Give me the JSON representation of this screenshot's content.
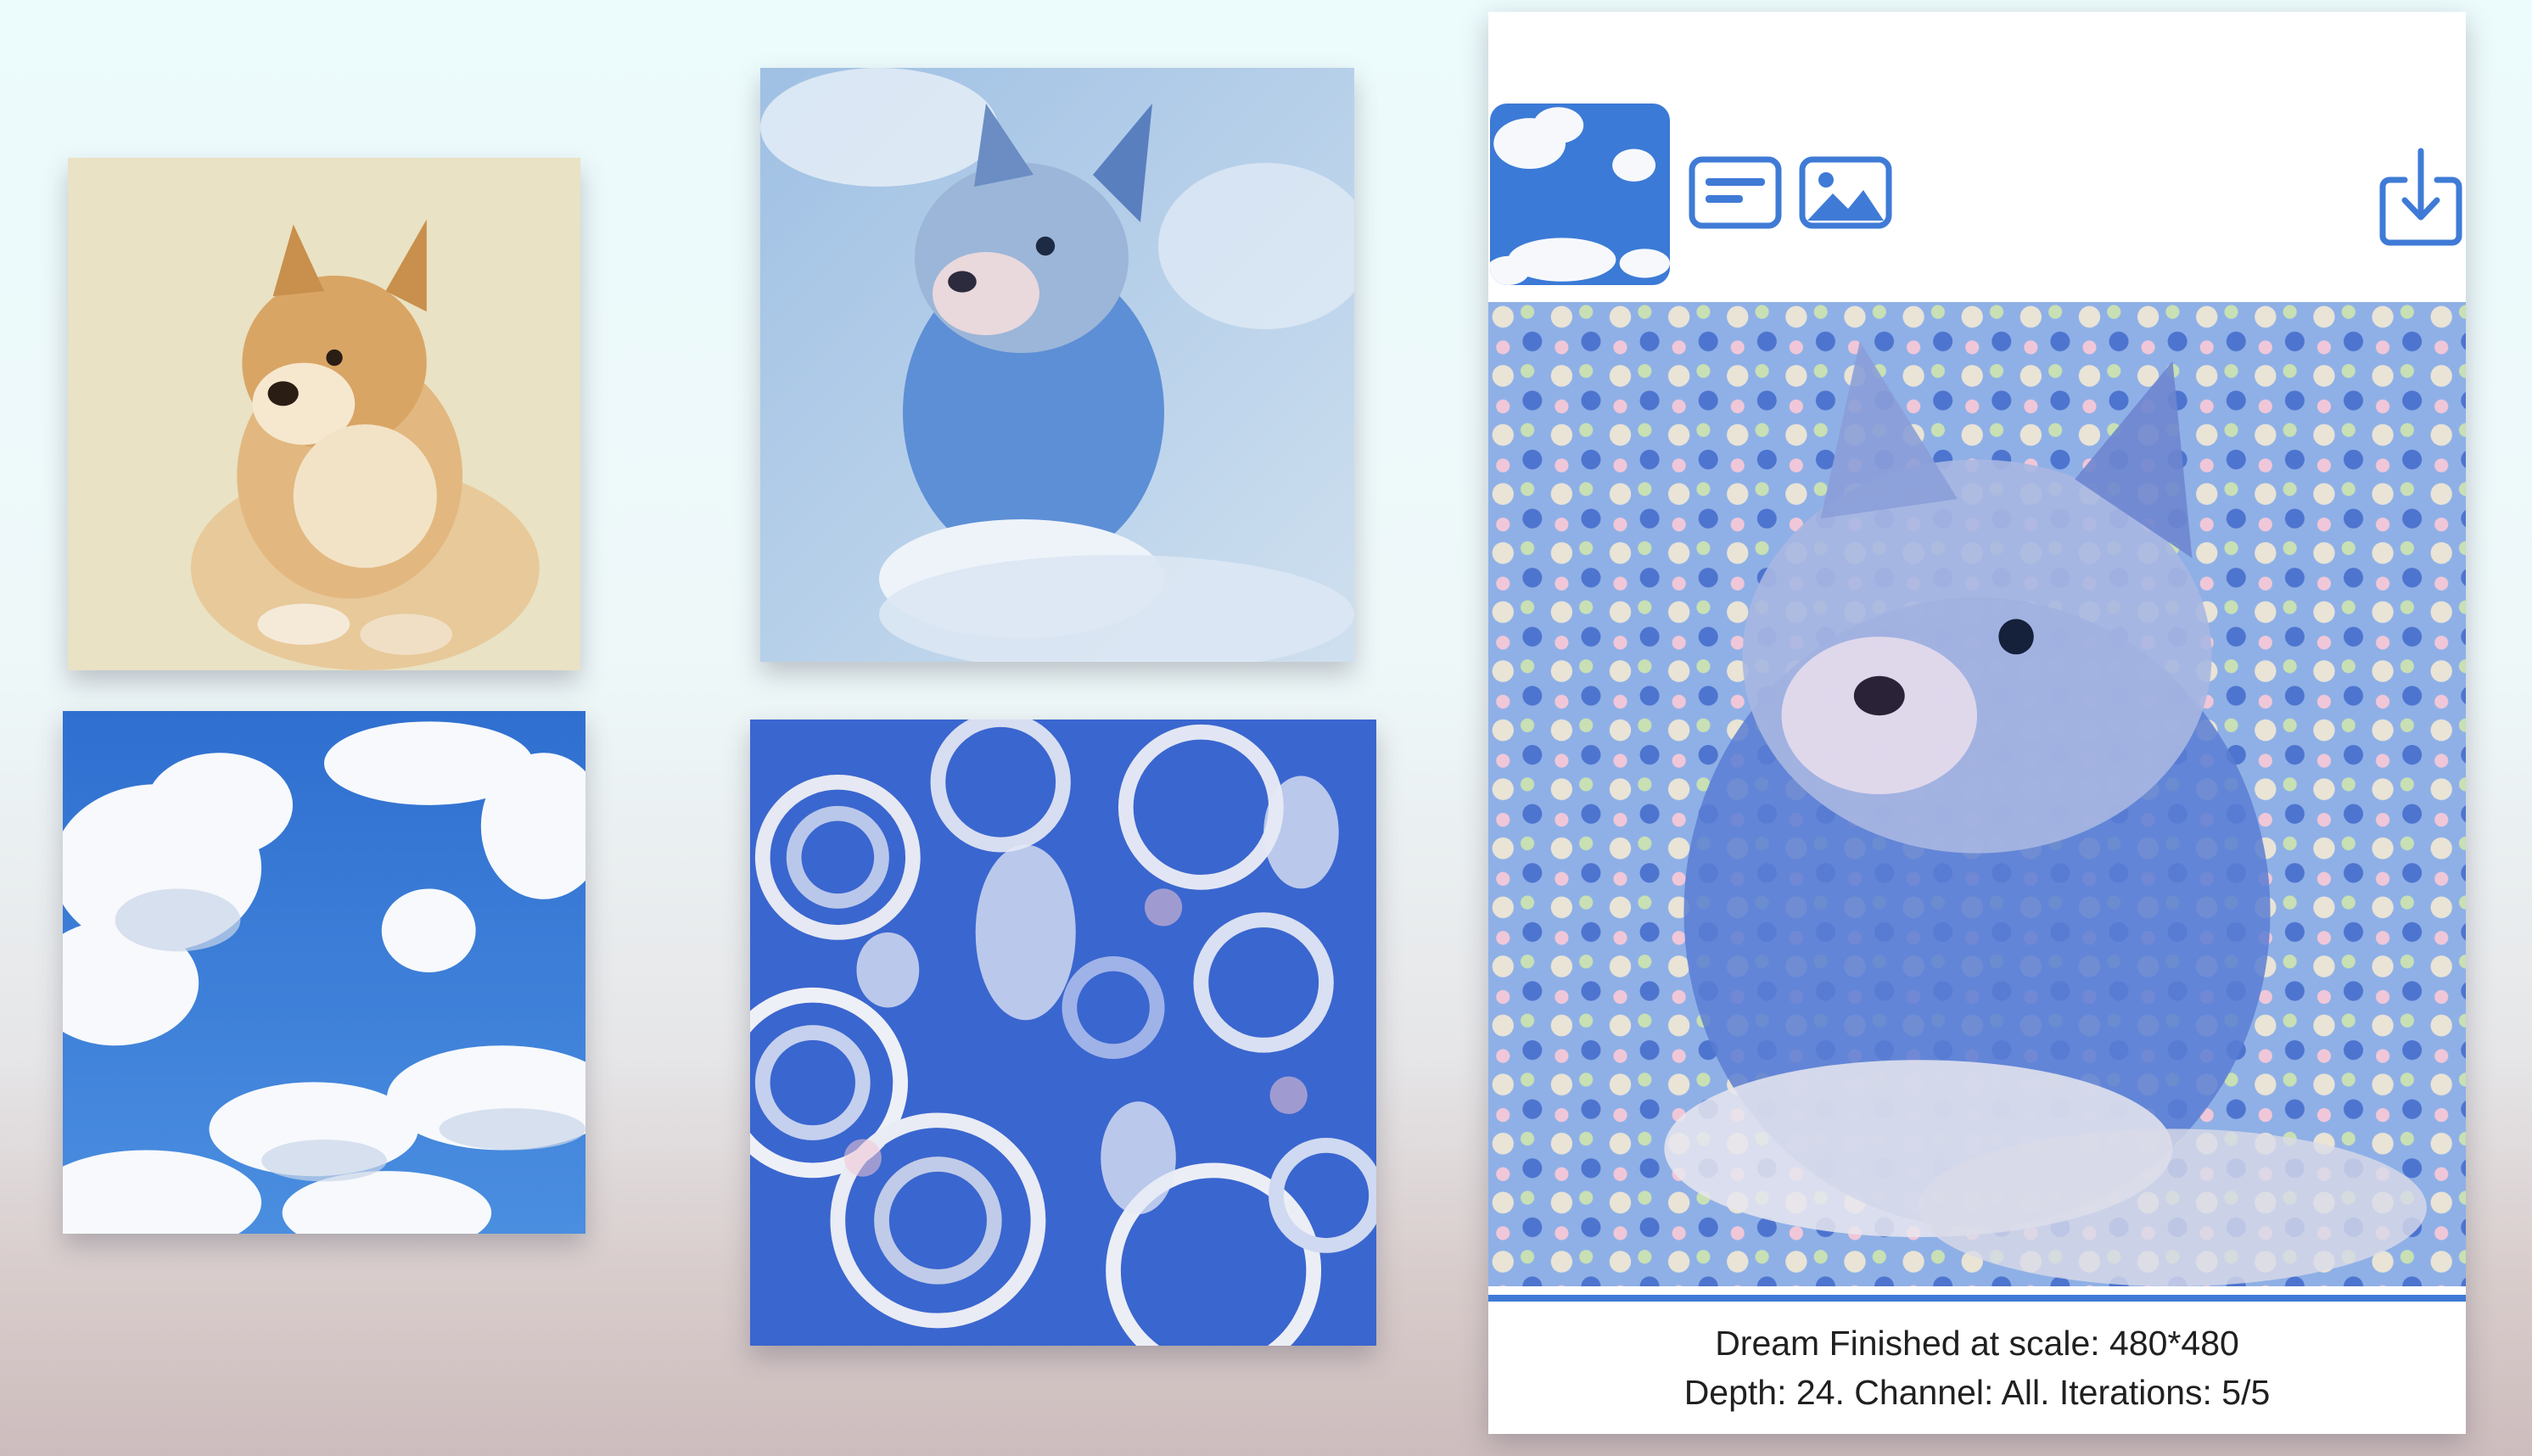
{
  "toolbar": {
    "thumbnail_icon": "cloud-style-thumbnail",
    "info_icon": "text-card-icon",
    "image_icon": "photo-icon",
    "download_icon": "download-tray-icon",
    "accent_color": "#3f7bd6"
  },
  "tiles": [
    {
      "name": "doge-photo",
      "content": "shiba inu dog"
    },
    {
      "name": "clouds-photo",
      "content": "blue sky with clouds"
    },
    {
      "name": "cloud-styled-doge",
      "content": "dog rendered in cloud texture"
    },
    {
      "name": "deep-dream-pattern",
      "content": "psychedelic dream texture"
    }
  ],
  "progress": {
    "fraction": 1.0
  },
  "status": {
    "line1": "Dream Finished at scale: 480*480",
    "line2": "Depth: 24. Channel: All. Iterations: 5/5"
  }
}
